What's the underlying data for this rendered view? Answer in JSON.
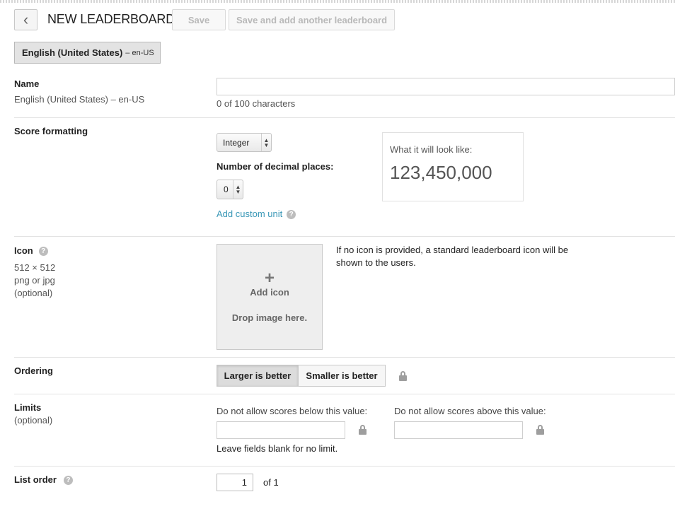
{
  "header": {
    "back_glyph": "‹",
    "title": "NEW LEADERBOARD",
    "save_label": "Save",
    "save_add_label": "Save and add another leaderboard"
  },
  "language_tab": {
    "name": "English (United States)",
    "code": "– en-US"
  },
  "name_section": {
    "label": "Name",
    "sublabel": "English (United States) – en-US",
    "value": "",
    "char_count": "0 of 100 characters"
  },
  "score_formatting": {
    "label": "Score formatting",
    "format_selected": "Integer",
    "decimal_label": "Number of decimal places:",
    "decimal_selected": "0",
    "add_unit_link": "Add custom unit",
    "preview_caption": "What it will look like:",
    "preview_value": "123,450,000"
  },
  "icon_section": {
    "label": "Icon",
    "size": "512 × 512",
    "formats": "png or jpg",
    "optional": "(optional)",
    "plus": "+",
    "add_icon": "Add icon",
    "drop_text": "Drop image here.",
    "note": "If no icon is provided, a standard leaderboard icon will be shown to the users."
  },
  "ordering": {
    "label": "Ordering",
    "options": [
      "Larger is better",
      "Smaller is better"
    ],
    "selected": "Larger is better"
  },
  "limits": {
    "label": "Limits",
    "optional": "(optional)",
    "min_label": "Do not allow scores below this value:",
    "max_label": "Do not allow scores above this value:",
    "min_value": "",
    "max_value": "",
    "hint": "Leave fields blank for no limit."
  },
  "list_order": {
    "label": "List order",
    "value": "1",
    "of_text": "of 1"
  },
  "colors": {
    "link": "#3a98b7",
    "selected_segment": "#dcdcdc"
  },
  "icons": [
    "back-chevron-icon",
    "help-icon",
    "lock-icon",
    "select-arrows-icon",
    "plus-icon"
  ]
}
